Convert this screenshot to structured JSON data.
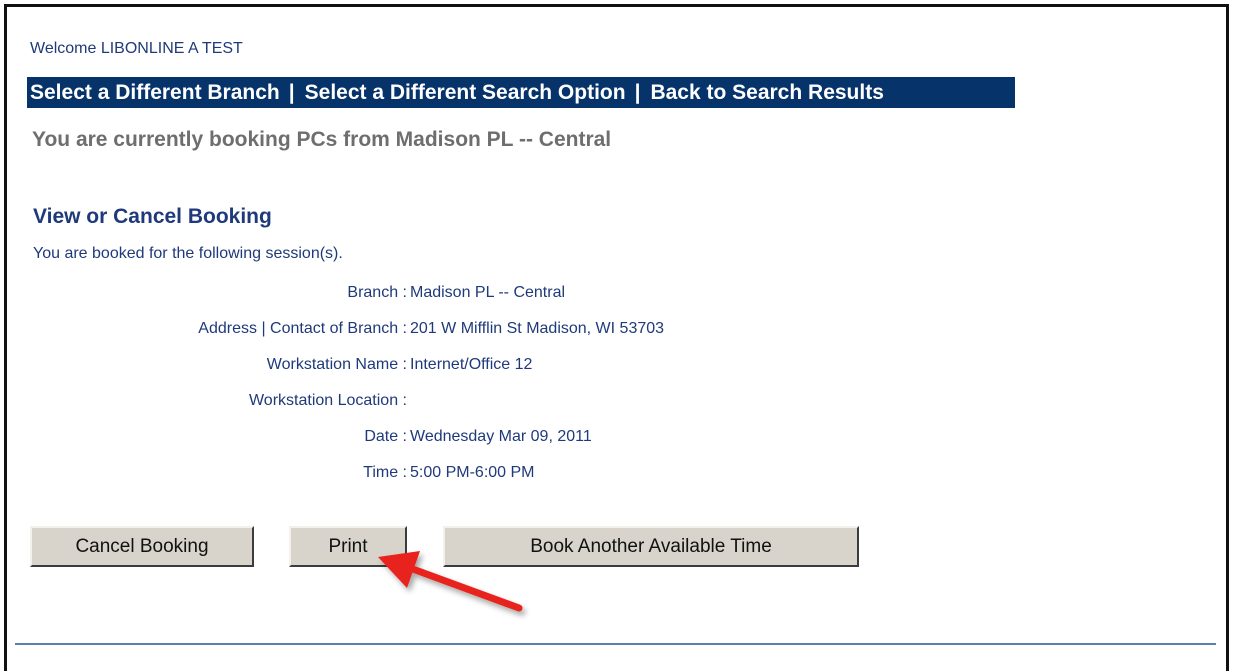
{
  "header": {
    "welcome": "Welcome LIBONLINE A TEST"
  },
  "nav": {
    "items": [
      {
        "label": "Select a Different Branch"
      },
      {
        "label": "Select a Different Search Option"
      },
      {
        "label": "Back to Search Results"
      }
    ],
    "separator": "|"
  },
  "booking_branch_text": "You are currently booking PCs from Madison PL -- Central",
  "section": {
    "title": "View or Cancel Booking",
    "intro": "You are booked for the following session(s)."
  },
  "details": [
    {
      "label": "Branch :",
      "value": "Madison PL -- Central"
    },
    {
      "label": "Address | Contact of Branch :",
      "value": "201 W Mifflin St Madison, WI 53703"
    },
    {
      "label": "Workstation Name :",
      "value": "Internet/Office 12"
    },
    {
      "label": "Workstation Location :",
      "value": ""
    },
    {
      "label": "Date :",
      "value": "Wednesday Mar 09, 2011"
    },
    {
      "label": "Time :",
      "value": "5:00 PM-6:00 PM"
    }
  ],
  "buttons": {
    "cancel": "Cancel Booking",
    "print": "Print",
    "book_another": "Book Another Available Time"
  },
  "colors": {
    "nav_bg": "#07336b",
    "text_blue": "#1f3a7a",
    "text_gray": "#6e6e6e",
    "arrow": "#e8231d",
    "button_face": "#d8d3cb"
  },
  "icons": {
    "annotation": "red-arrow-icon"
  }
}
